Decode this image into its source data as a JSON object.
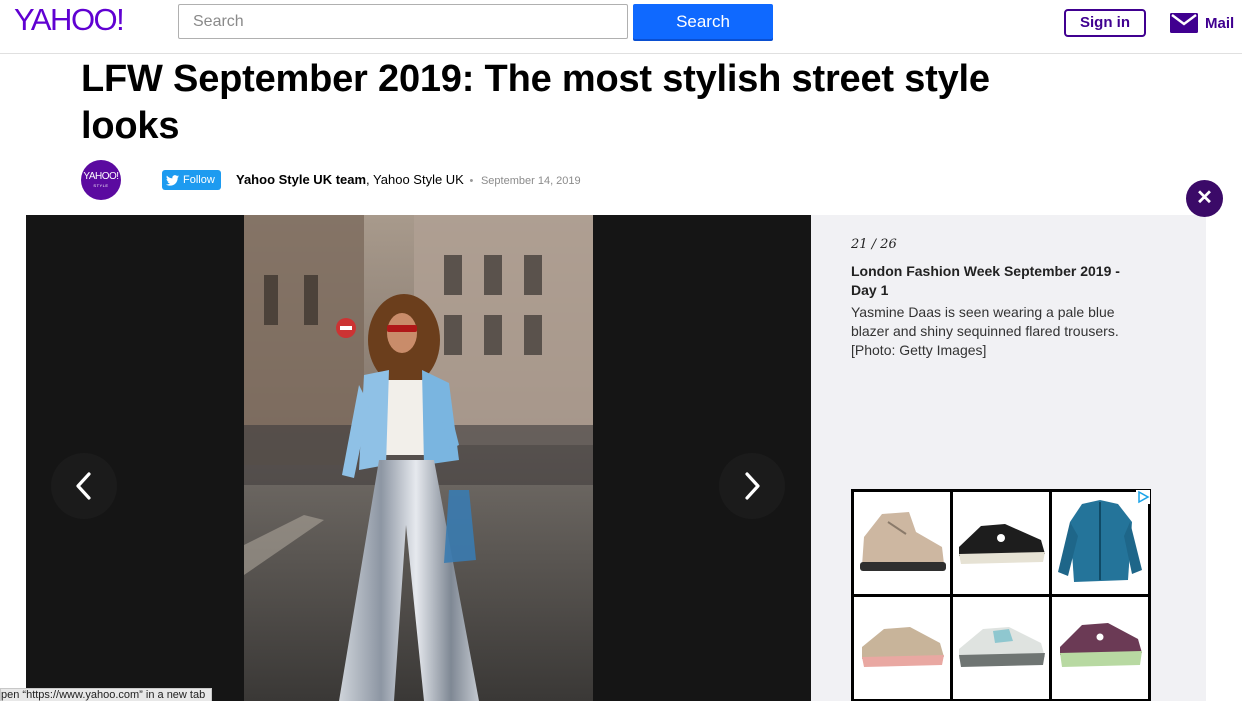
{
  "header": {
    "logo": "YAHOO!",
    "search_placeholder": "Search",
    "search_button": "Search",
    "signin": "Sign in",
    "mail": "Mail"
  },
  "article": {
    "headline": "LFW September 2019: The most stylish street style looks",
    "avatar_text": "YAHOO!",
    "avatar_sub": "STYLE",
    "follow_label": "Follow",
    "author": "Yahoo Style UK team",
    "publication": "Yahoo Style UK",
    "date": "September 14, 2019"
  },
  "slideshow": {
    "counter": "21 / 26",
    "caption_title": "London Fashion Week September 2019 - Day 1",
    "caption_text": "Yasmine Daas is seen wearing a pale blue blazer and shiny sequinned flared trousers. [Photo: Getty Images]"
  },
  "ad": {
    "items": [
      "beige-hiking-shoe",
      "black-running-shoe",
      "teal-jacket",
      "beige-pink-shoe",
      "grey-running-shoe",
      "green-purple-shoe"
    ]
  },
  "status_bar": "pen “https://www.yahoo.com” in a new tab",
  "colors": {
    "yahoo_purple": "#6001d2",
    "search_blue": "#0f69ff",
    "close_purple": "#3b0a68",
    "twitter_blue": "#1d9bf0"
  }
}
